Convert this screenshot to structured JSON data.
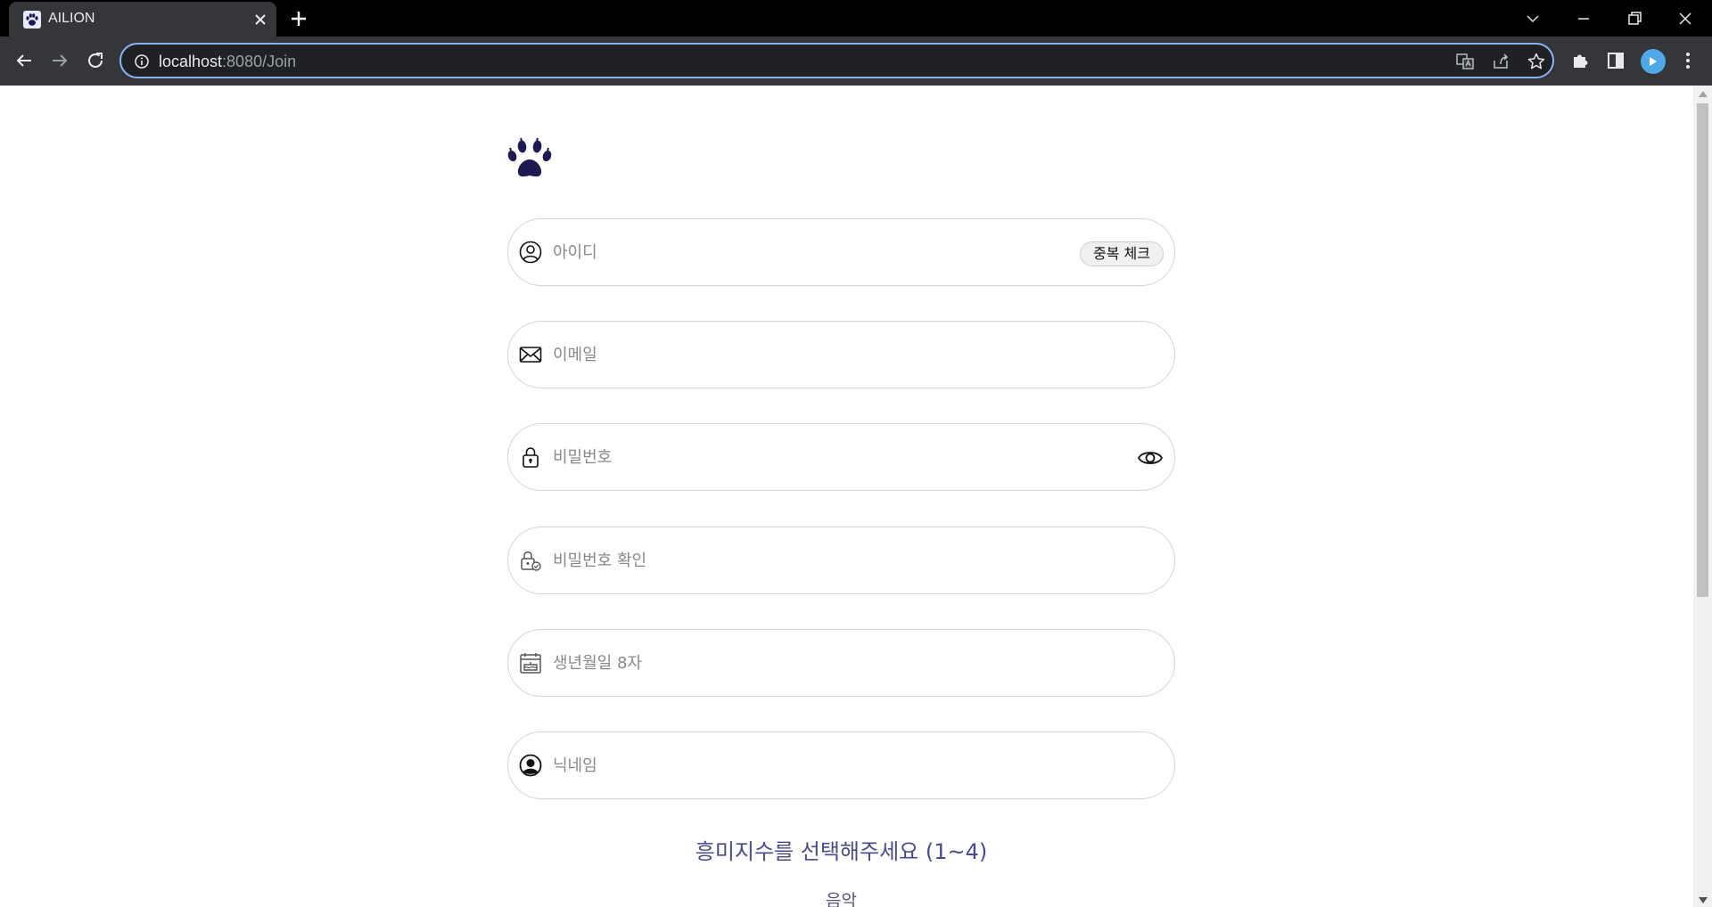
{
  "browser": {
    "tab_title": "AILION",
    "url_host": "localhost",
    "url_path": ":8080/Join"
  },
  "form": {
    "username_placeholder": "아이디",
    "duplicate_check_label": "중복 체크",
    "email_placeholder": "이메일",
    "password_placeholder": "비밀번호",
    "password_confirm_placeholder": "비밀번호 확인",
    "birthdate_placeholder": "생년월일 8자",
    "nickname_placeholder": "닉네임"
  },
  "interests": {
    "title": "흥미지수를 선택해주세요 (1~4)",
    "first_item": "음악"
  },
  "colors": {
    "accent": "#4b4a8c",
    "logo": "#1d1a52",
    "omnibox_focus": "#8ab4f8"
  }
}
